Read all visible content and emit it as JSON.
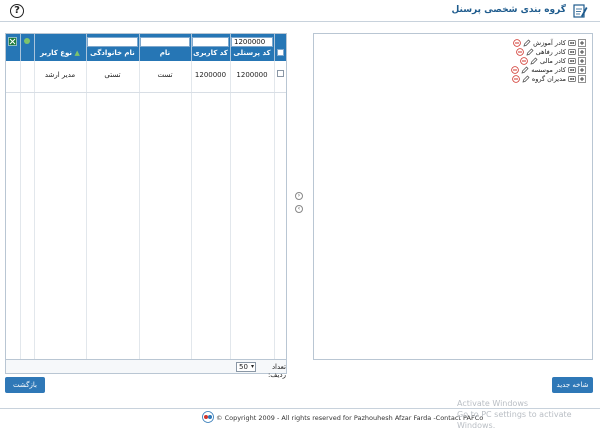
{
  "header": {
    "title": "گروه بندی شخصی پرسنل",
    "help_icon": "?"
  },
  "grid": {
    "filters": {
      "personnel_code": "1200000",
      "user_code": "",
      "name": "",
      "family": ""
    },
    "columns": [
      "کد پرسنلی",
      "کد کاربری",
      "نام",
      "نام خانوادگی",
      "نوع کاربر"
    ],
    "rows": [
      {
        "personnel_code": "1200000",
        "user_code": "1200000",
        "name": "تست",
        "family": "تستی",
        "user_type": "مدیر ارشد"
      }
    ],
    "footer": {
      "page_size": "50",
      "page_size_label": "تعداد ردیف:"
    }
  },
  "tree": {
    "items": [
      "کادر آموزش",
      "کادر رفاهی",
      "کادر مالی",
      "کادر موسسه",
      "مدیران گروه"
    ]
  },
  "buttons": {
    "back": "بازگشت",
    "new_branch": "شاخه جدید"
  },
  "footer": {
    "copyright": "© Copyright 2009 - All rights reserved for Pazhouhesh Afzar Farda -Contact PAFCo"
  },
  "watermark": {
    "line1": "Activate Windows",
    "line2": "Go to PC settings to activate Windows."
  },
  "colors": {
    "header_blue": "#2676b5",
    "button_blue": "#2f78b7",
    "title_blue": "#1e5b8d"
  }
}
